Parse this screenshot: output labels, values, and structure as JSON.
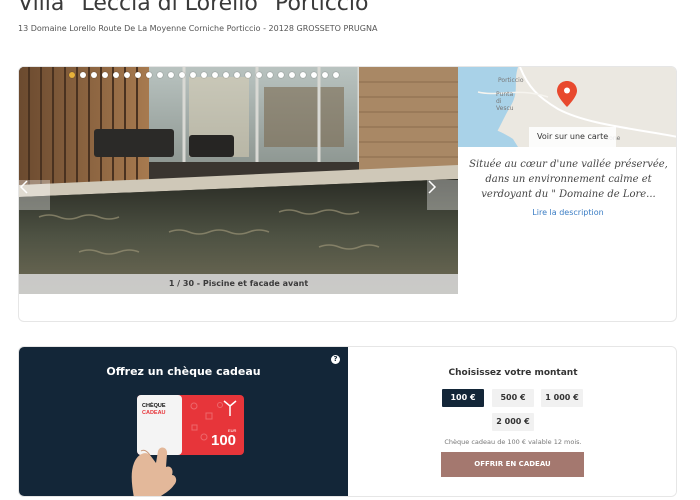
{
  "header": {
    "title": "Villa \"Leccia di Lorello\" Porticcio",
    "address": "13 Domaine Lorello Route De La Moyenne Corniche Porticcio - 20128 GROSSETO PRUGNA"
  },
  "gallery": {
    "caption": "1 / 30 - Piscine et facade avant",
    "current": 1,
    "total": 30,
    "visible_dots": 25,
    "prev_icon": "chevron-left-icon",
    "next_icon": "chevron-right-icon"
  },
  "map": {
    "towns": [
      "Porticcio",
      "Punta di Vescu",
      "zone"
    ],
    "button_label": "Voir sur une carte",
    "pin_icon": "map-pin-icon",
    "pin_color": "#e8492e"
  },
  "description": {
    "text": "Située au cœur d'une vallée préservée, dans un environnement calme et verdoyant du \" Domaine de Lore...",
    "read_more": "Lire la description"
  },
  "gift": {
    "title": "Offrez un chèque cadeau",
    "help_icon": "question-icon",
    "card": {
      "label_line1": "CHÈQUE",
      "label_line2": "CADEAU",
      "amount": "100",
      "currency": "EUR",
      "color": "#e7353a"
    },
    "amount_heading": "Choisissez votre montant",
    "amounts": [
      "100 €",
      "500 €",
      "1 000 €",
      "2 000 €"
    ],
    "selected_amount": "100 €",
    "validity_note": "Chèque cadeau de 100 € valable 12 mois.",
    "offer_button": "OFFRIR EN CADEAU",
    "colors": {
      "panel": "#132638",
      "button": "#a4786f"
    }
  }
}
